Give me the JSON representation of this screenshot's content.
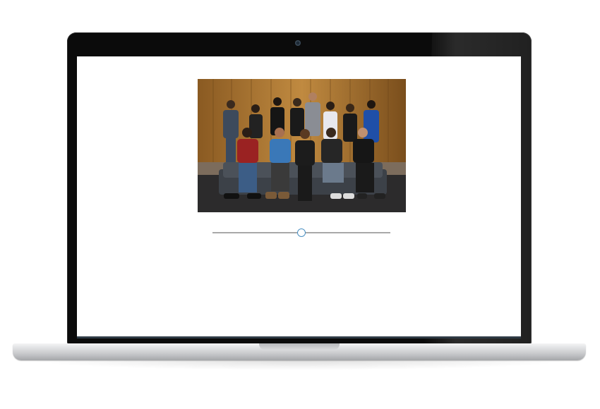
{
  "device": {
    "type": "laptop",
    "accent_color": "#4a90c2"
  },
  "screen": {
    "image": {
      "subject": "team-group-photo",
      "alt": ""
    },
    "slider": {
      "value_fraction": 0.5
    }
  }
}
